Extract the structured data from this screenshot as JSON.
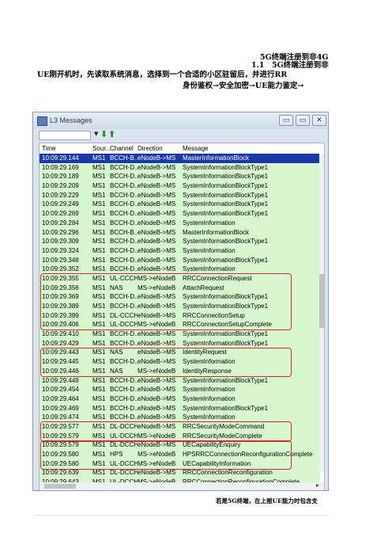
{
  "document": {
    "title": "5G终端注册到非4G",
    "section": "1.1　5G终端注册到非",
    "paragraph_line1": "UE刚开机时，先读取系统消息，选择到一个合适的小区驻留后，并进行RR",
    "paragraph_line2": "身份鉴权→安全加密→UE能力鉴定→",
    "caption": "若是5G终端，在上报UE能力时包含支"
  },
  "window": {
    "title": "L3 Messages",
    "minimize_glyph": "▭",
    "maximize_glyph": "▭",
    "close_glyph": "✕"
  },
  "toolbar": {
    "dropdown_glyph": "▼",
    "down_glyph": "⬇",
    "up_glyph": "⬆"
  },
  "columns": [
    "Time",
    "Sour...",
    "Channel",
    "Direction",
    "Message"
  ],
  "rows": [
    {
      "time": "10:09:29.144",
      "src": "MS1",
      "ch": "BCCH-B...",
      "dir": "eNodeB->MS",
      "msg": "MasterInformationBlock",
      "selected": true
    },
    {
      "time": "10:09:29.169",
      "src": "MS1",
      "ch": "BCCH-D...",
      "dir": "eNodeB->MS",
      "msg": "SystemInformationBlockType1"
    },
    {
      "time": "10:09:29.189",
      "src": "MS1",
      "ch": "BCCH-D...",
      "dir": "eNodeB->MS",
      "msg": "SystemInformationBlockType1"
    },
    {
      "time": "10:09:29.209",
      "src": "MS1",
      "ch": "BCCH-D...",
      "dir": "eNodeB->MS",
      "msg": "SystemInformationBlockType1"
    },
    {
      "time": "10:09:29.229",
      "src": "MS1",
      "ch": "BCCH-D...",
      "dir": "eNodeB->MS",
      "msg": "SystemInformationBlockType1"
    },
    {
      "time": "10:09:29.249",
      "src": "MS1",
      "ch": "BCCH-D...",
      "dir": "eNodeB->MS",
      "msg": "SystemInformationBlockType1"
    },
    {
      "time": "10:09:29.269",
      "src": "MS1",
      "ch": "BCCH-D...",
      "dir": "eNodeB->MS",
      "msg": "SystemInformationBlockType1"
    },
    {
      "time": "10:09:29.284",
      "src": "MS1",
      "ch": "BCCH-D...",
      "dir": "eNodeB->MS",
      "msg": "SystemInformation"
    },
    {
      "time": "10:09:29.296",
      "src": "MS1",
      "ch": "BCCH-B...",
      "dir": "eNodeB->MS",
      "msg": "MasterInformationBlock"
    },
    {
      "time": "10:09:29.309",
      "src": "MS1",
      "ch": "BCCH-D...",
      "dir": "eNodeB->MS",
      "msg": "SystemInformationBlockType1"
    },
    {
      "time": "10:09:29.324",
      "src": "MS1",
      "ch": "BCCH-D...",
      "dir": "eNodeB->MS",
      "msg": "SystemInformation"
    },
    {
      "time": "10:09:29.348",
      "src": "MS1",
      "ch": "BCCH-D...",
      "dir": "eNodeB->MS",
      "msg": "SystemInformationBlockType1"
    },
    {
      "time": "10:09:29.352",
      "src": "MS1",
      "ch": "BCCH-D...",
      "dir": "eNodeB->MS",
      "msg": "SystemInformation"
    },
    {
      "time": "10:09:29.355",
      "src": "MS1",
      "ch": "UL-CCCH",
      "dir": "MS->eNodeB",
      "msg": "RRCConnectionRequest"
    },
    {
      "time": "10:09:29.356",
      "src": "MS1",
      "ch": "NAS",
      "dir": "MS->eNodeB",
      "msg": "AttachRequest"
    },
    {
      "time": "10:09:29.369",
      "src": "MS1",
      "ch": "BCCH-D...",
      "dir": "eNodeB->MS",
      "msg": "SystemInformationBlockType1"
    },
    {
      "time": "10:09:29.389",
      "src": "MS1",
      "ch": "BCCH-D...",
      "dir": "eNodeB->MS",
      "msg": "SystemInformationBlockType1"
    },
    {
      "time": "10:09:29.399",
      "src": "MS1",
      "ch": "DL-CCCH",
      "dir": "eNodeB->MS",
      "msg": "RRCConnectionSetup"
    },
    {
      "time": "10:09:29.406",
      "src": "MS1",
      "ch": "UL-DCCH",
      "dir": "MS->eNodeB",
      "msg": "RRCConnectionSetupComplete"
    },
    {
      "time": "10:09:29.410",
      "src": "MS1",
      "ch": "BCCH-D...",
      "dir": "eNodeB->MS",
      "msg": "SystemInformationBlockType1"
    },
    {
      "time": "10:09:29.429",
      "src": "MS1",
      "ch": "BCCH-D...",
      "dir": "eNodeB->MS",
      "msg": "SystemInformationBlockType1"
    },
    {
      "time": "10:09:29.443",
      "src": "MS1",
      "ch": "NAS",
      "dir": "eNodeB->MS",
      "msg": "IdentityRequest"
    },
    {
      "time": "10:09:29.445",
      "src": "MS1",
      "ch": "BCCH-D...",
      "dir": "eNodeB->MS",
      "msg": "SystemInformation"
    },
    {
      "time": "10:09:29.446",
      "src": "MS1",
      "ch": "NAS",
      "dir": "MS->eNodeB",
      "msg": "IdentityResponse"
    },
    {
      "time": "10:09:29.449",
      "src": "MS1",
      "ch": "BCCH-D...",
      "dir": "eNodeB->MS",
      "msg": "SystemInformationBlockType1"
    },
    {
      "time": "10:09:29.454",
      "src": "MS1",
      "ch": "BCCH-D...",
      "dir": "eNodeB->MS",
      "msg": "SystemInformation"
    },
    {
      "time": "10:09:29.464",
      "src": "MS1",
      "ch": "BCCH-D...",
      "dir": "eNodeB->MS",
      "msg": "SystemInformation"
    },
    {
      "time": "10:09:29.469",
      "src": "MS1",
      "ch": "BCCH-D...",
      "dir": "eNodeB->MS",
      "msg": "SystemInformationBlockType1"
    },
    {
      "time": "10:09:29.474",
      "src": "MS1",
      "ch": "BCCH-D...",
      "dir": "eNodeB->MS",
      "msg": "SystemInformation"
    },
    {
      "time": "10:09:29.577",
      "src": "MS1",
      "ch": "DL-DCCH",
      "dir": "eNodeB->MS",
      "msg": "RRCSecurityModeCommand"
    },
    {
      "time": "10:09:29.579",
      "src": "MS1",
      "ch": "UL-DCCH",
      "dir": "MS->eNodeB",
      "msg": "RRCSecurityModeComplete"
    },
    {
      "time": "10:09:29.579",
      "src": "MS1",
      "ch": "DL-DCCH",
      "dir": "eNodeB->MS",
      "msg": "UECapabilityEnquiry"
    },
    {
      "time": "10:09:29.580",
      "src": "MS1",
      "ch": "HPS",
      "dir": "MS->eNodeB",
      "msg": "HPSRRCConnectionReconfigurationComplete"
    },
    {
      "time": "10:09:29.580",
      "src": "MS1",
      "ch": "UL-DCCH",
      "dir": "MS->eNodeB",
      "msg": "UECapabilityInformation"
    },
    {
      "time": "10:09:29.639",
      "src": "MS1",
      "ch": "DL-DCCH",
      "dir": "eNodeB->MS",
      "msg": "RRCConnectionReconfiguration"
    },
    {
      "time": "10:09:29.643",
      "src": "MS1",
      "ch": "UL-DCCH",
      "dir": "MS->eNodeB",
      "msg": "RRCConnectionReconfigurationComplete"
    }
  ],
  "colors": {
    "row_bg": "#d7f7cf",
    "selected_bg": "#1b38a8",
    "highlight_border": "#e0252d"
  }
}
